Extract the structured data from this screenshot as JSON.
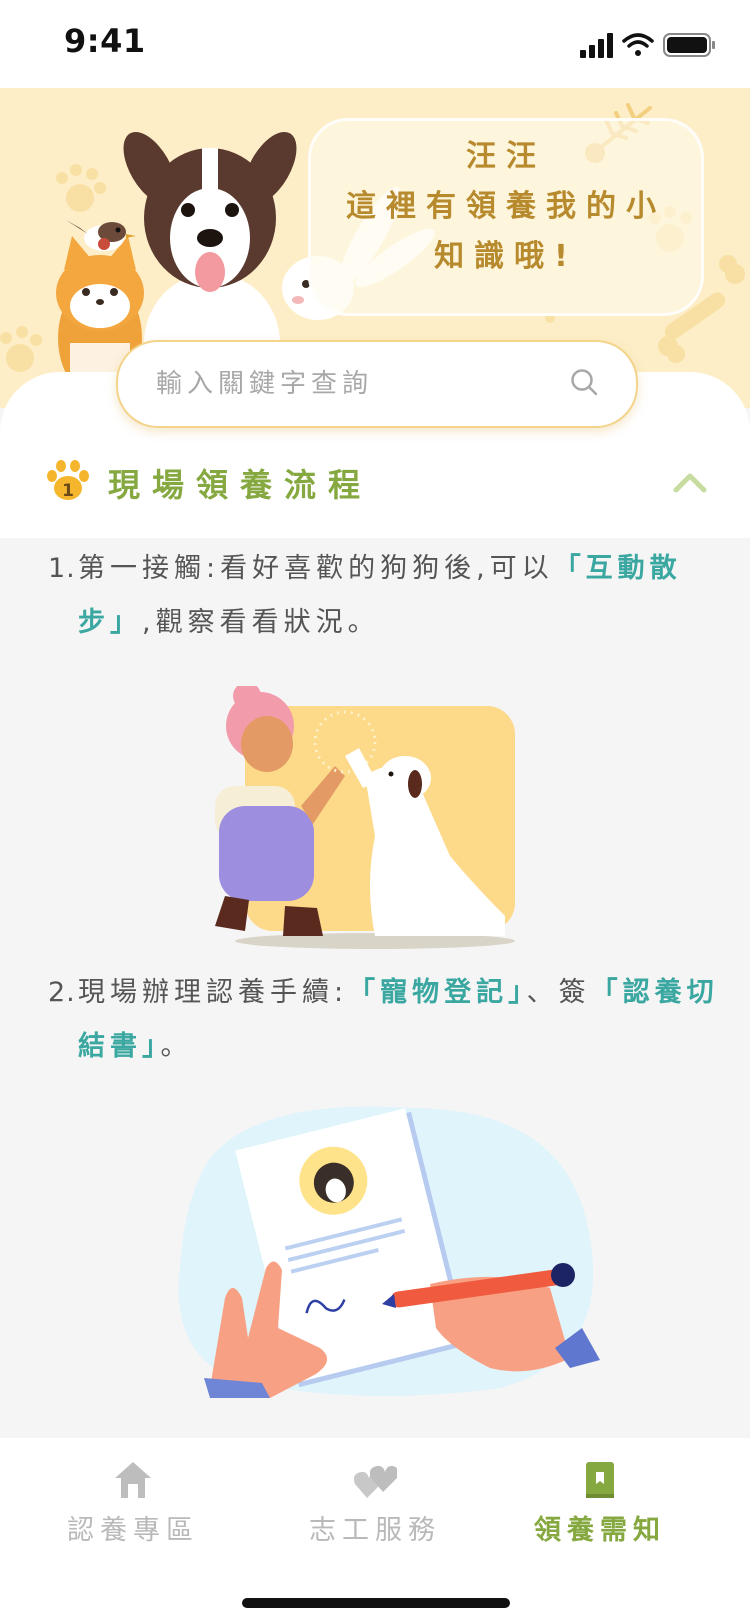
{
  "status_bar": {
    "time": "9:41"
  },
  "hero": {
    "bubble_lines": [
      "汪汪",
      "這裡有領養我的小",
      "知識哦!"
    ]
  },
  "search": {
    "placeholder": "輸入關鍵字查詢"
  },
  "section": {
    "badge_number": "1",
    "title": "現場領養流程"
  },
  "steps": [
    {
      "number": "1.",
      "text_before": "第一接觸:看好喜歡的狗狗後,可以",
      "highlight1": "「互動散步」",
      "text_after": ",觀察看看狀況。"
    },
    {
      "number": "2.",
      "text_before": "現場辦理認養手續:",
      "highlight1": "「寵物登記」",
      "text_middle": "、簽",
      "highlight2": "「認養切結書」",
      "text_after": "。"
    }
  ],
  "tabs": [
    {
      "label": "認養專區",
      "icon": "home-icon",
      "active": false
    },
    {
      "label": "志工服務",
      "icon": "hearts-icon",
      "active": false
    },
    {
      "label": "領養需知",
      "icon": "book-icon",
      "active": true
    }
  ],
  "colors": {
    "accent_green": "#86a840",
    "teal_highlight": "#3aa7a1",
    "hero_bg": "#fdeec7",
    "search_border": "#f3d48a"
  }
}
